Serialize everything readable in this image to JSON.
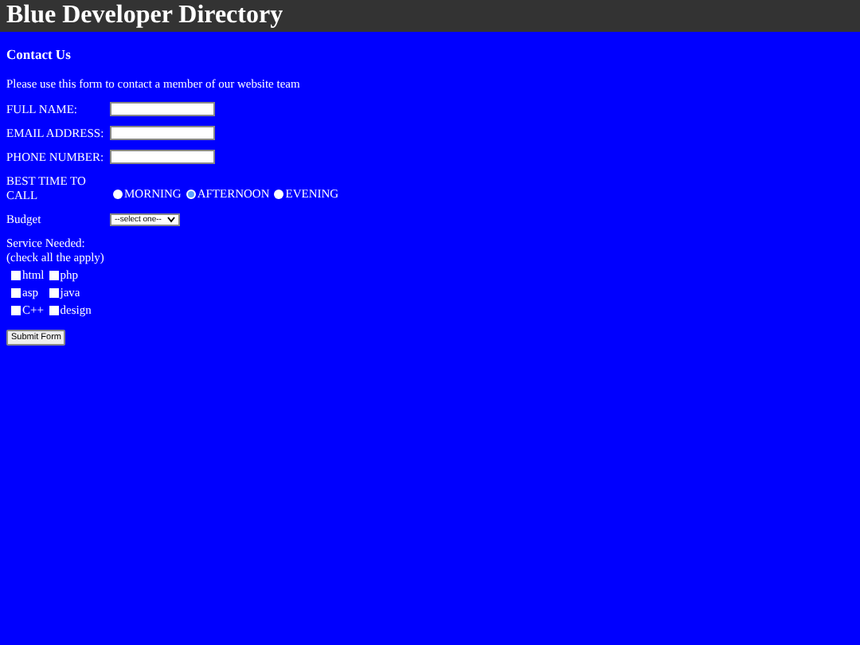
{
  "header": {
    "title": "Blue Developer Directory"
  },
  "form": {
    "heading": "Contact Us",
    "intro": "Please use this form to contact a member of our website team",
    "fields": [
      {
        "label": "FULL NAME:"
      },
      {
        "label": "EMAIL ADDRESS:"
      },
      {
        "label": "PHONE NUMBER:"
      }
    ],
    "best_time": {
      "label": "BEST TIME TO CALL",
      "options": [
        {
          "label": "MORNING",
          "selected": false
        },
        {
          "label": "AFTERNOON",
          "selected": true
        },
        {
          "label": "EVENING",
          "selected": false
        }
      ]
    },
    "budget": {
      "label": "Budget",
      "value": "--select one--"
    },
    "services": {
      "label": "Service Needed:",
      "hint": "(check all the apply)",
      "options": [
        {
          "label": "html",
          "checked": false
        },
        {
          "label": "php",
          "checked": false
        },
        {
          "label": "asp",
          "checked": false
        },
        {
          "label": "java",
          "checked": false
        },
        {
          "label": "C++",
          "checked": false
        },
        {
          "label": "design",
          "checked": false
        }
      ]
    },
    "submit": "Submit Form"
  }
}
